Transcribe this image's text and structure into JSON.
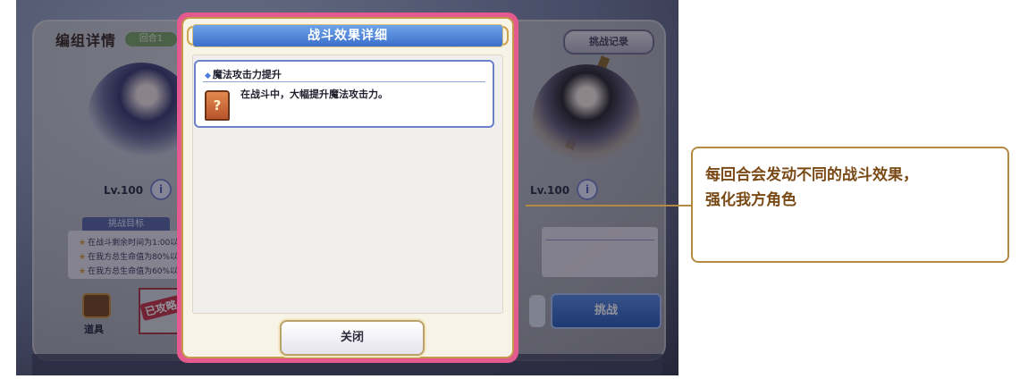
{
  "game": {
    "header_title": "编组详情",
    "round_label": "回合1",
    "record_button": "挑战记录",
    "left_character": {
      "level": "Lv.100"
    },
    "right_character": {
      "level": "Lv.100"
    },
    "info_icon": "i",
    "goal_tab": "挑战目标",
    "goals": [
      "在战斗剩余时间为1:00以",
      "在我方总生命值为80%以",
      "在我方总生命值为60%以"
    ],
    "item_label": "道具",
    "cleared_stamp": "已攻略",
    "challenge_button": "挑战"
  },
  "dialog": {
    "title": "战斗效果详细",
    "effects": [
      {
        "name": "魔法攻击力提升",
        "description": "在战斗中，大幅提升魔法攻击力。",
        "icon": "?"
      }
    ],
    "close_button": "关闭"
  },
  "callout": {
    "line1": "每回合会发动不同的战斗效果，",
    "line2": "强化我方角色"
  }
}
